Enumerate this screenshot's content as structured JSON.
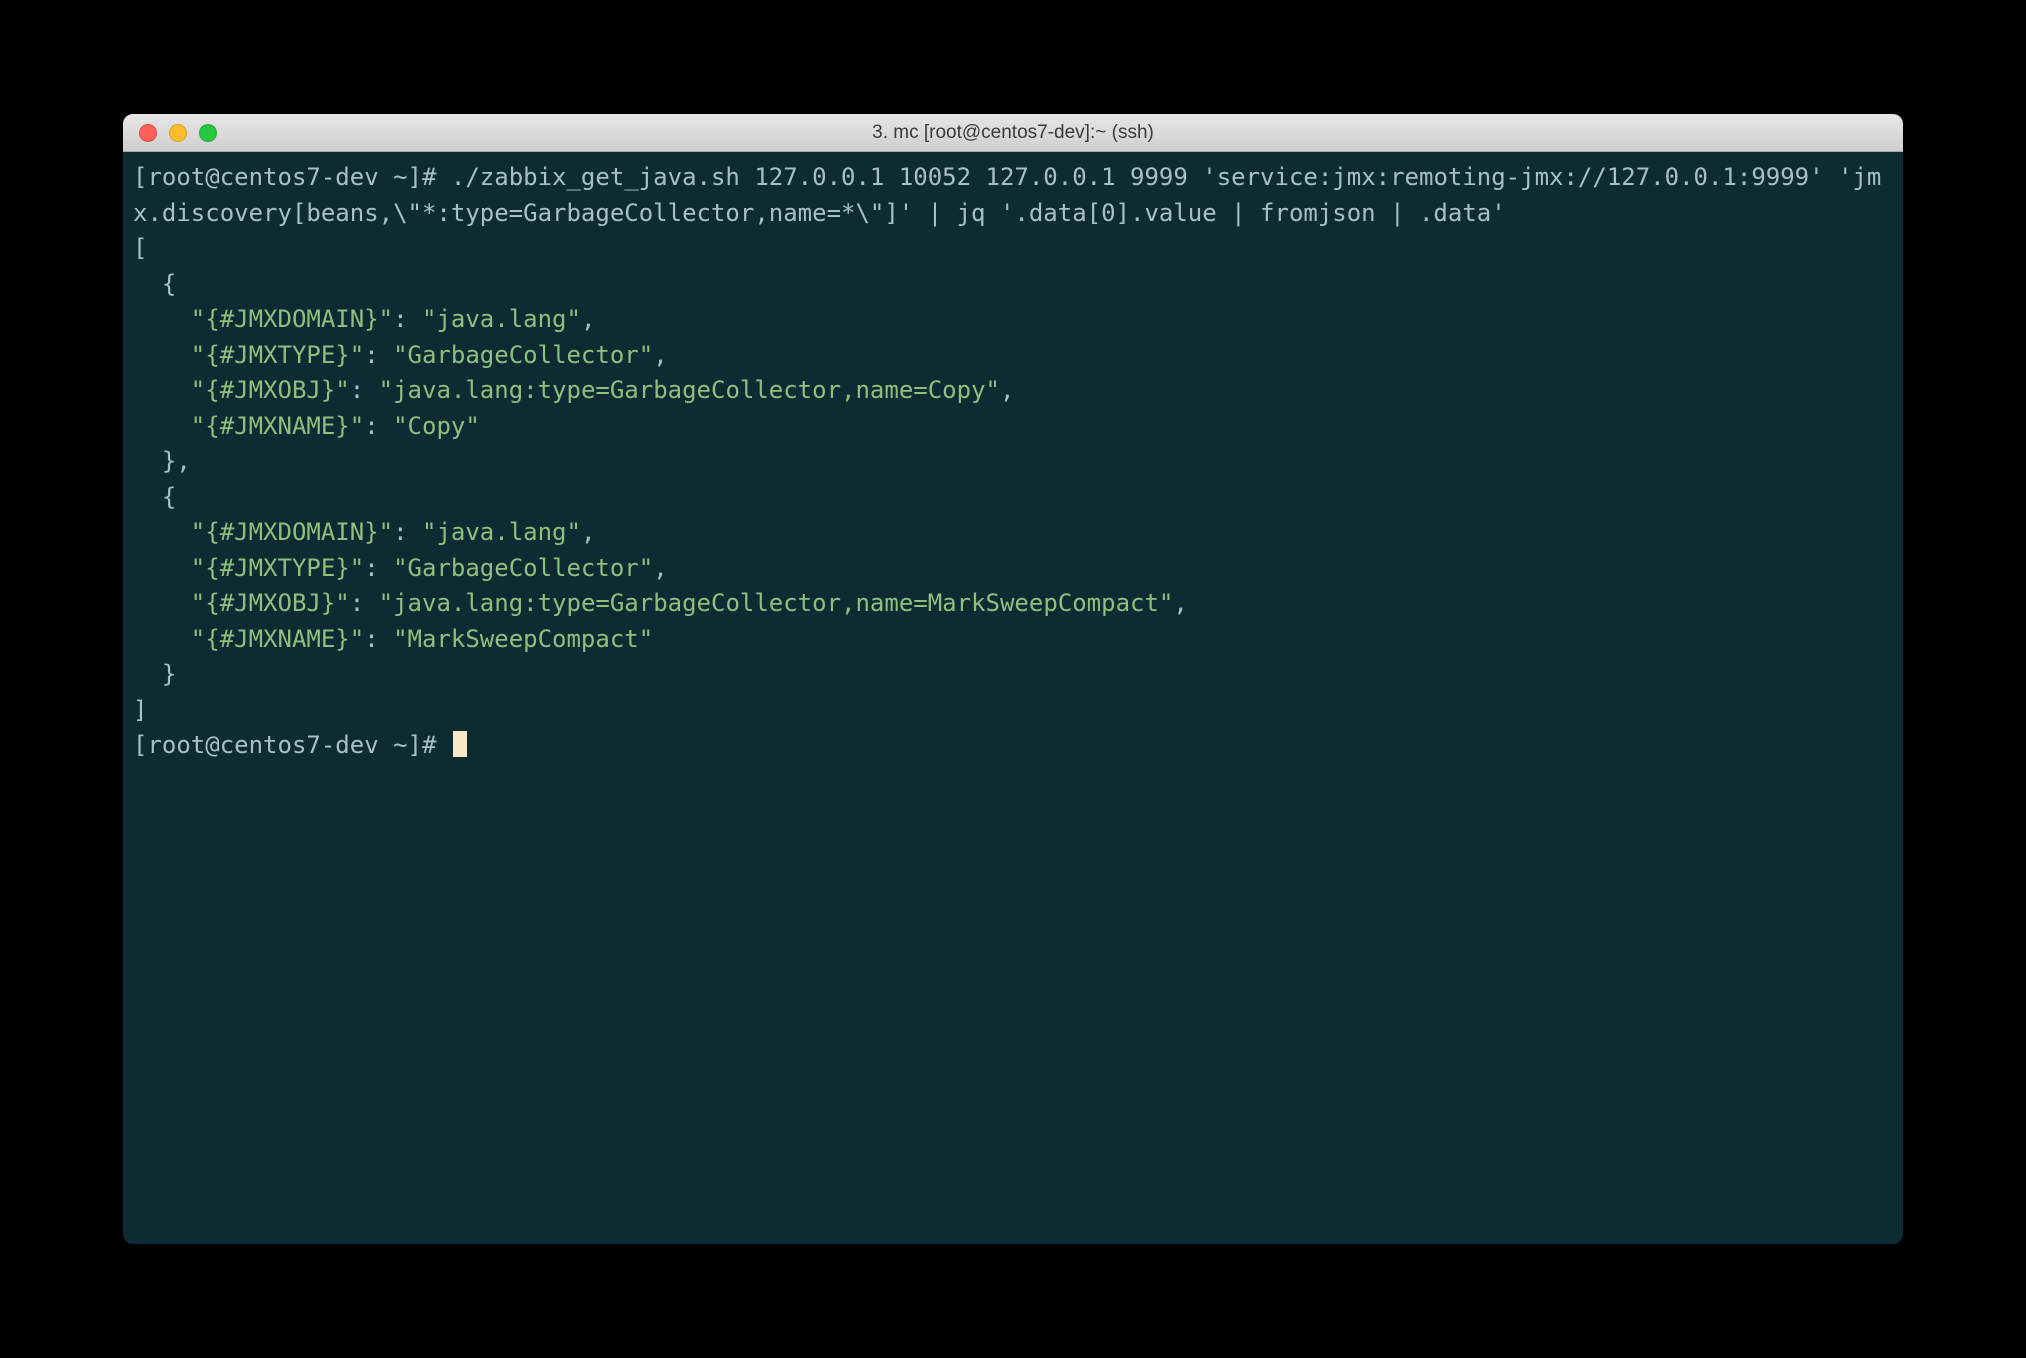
{
  "window": {
    "title": "3. mc [root@centos7-dev]:~ (ssh)"
  },
  "terminal": {
    "prompt1": "[root@centos7-dev ~]# ",
    "command": "./zabbix_get_java.sh 127.0.0.1 10052 127.0.0.1 9999 'service:jmx:remoting-jmx://127.0.0.1:9999' 'jmx.discovery[beans,\\\"*:type=GarbageCollector,name=*\\\"]' | jq '.data[0].value | fromjson | .data'",
    "json_open": "[",
    "obj_open": "  {",
    "obj_close_comma": "  },",
    "obj_close": "  }",
    "json_close": "]",
    "entries": [
      {
        "k1": "\"{#JMXDOMAIN}\"",
        "v1": "\"java.lang\"",
        "k2": "\"{#JMXTYPE}\"",
        "v2": "\"GarbageCollector\"",
        "k3": "\"{#JMXOBJ}\"",
        "v3": "\"java.lang:type=GarbageCollector,name=Copy\"",
        "k4": "\"{#JMXNAME}\"",
        "v4": "\"Copy\""
      },
      {
        "k1": "\"{#JMXDOMAIN}\"",
        "v1": "\"java.lang\"",
        "k2": "\"{#JMXTYPE}\"",
        "v2": "\"GarbageCollector\"",
        "k3": "\"{#JMXOBJ}\"",
        "v3": "\"java.lang:type=GarbageCollector,name=MarkSweepCompact\"",
        "k4": "\"{#JMXNAME}\"",
        "v4": "\"MarkSweepCompact\""
      }
    ],
    "indent": "    ",
    "colon": ": ",
    "comma": ",",
    "prompt2": "[root@centos7-dev ~]# "
  }
}
